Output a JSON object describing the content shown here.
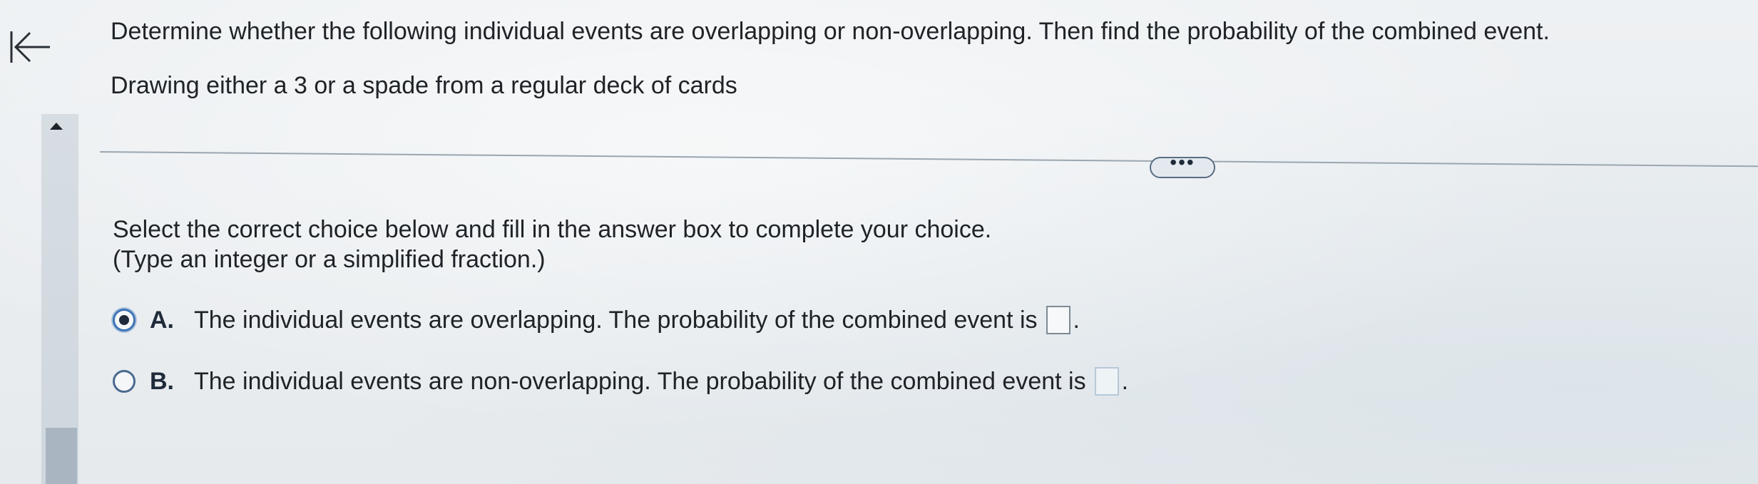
{
  "question": {
    "prompt": "Determine whether the following individual events are overlapping or non-overlapping. Then find the probability of the combined event.",
    "scenario": "Drawing either a 3 or a spade from a regular deck of cards"
  },
  "more_button": {
    "label": "•••"
  },
  "instructions": {
    "line1": "Select the correct choice below and fill in the answer box to complete your choice.",
    "line2": "(Type an integer or a simplified fraction.)"
  },
  "choices": [
    {
      "letter": "A.",
      "text": "The individual events are overlapping. The probability of the combined event is",
      "selected": true,
      "answer_value": ""
    },
    {
      "letter": "B.",
      "text": "The individual events are non-overlapping. The probability of the combined event is",
      "selected": false,
      "answer_value": ""
    }
  ],
  "icons": {
    "back": "back-to-start-icon",
    "scroll_up": "scroll-up-arrow-icon"
  },
  "colors": {
    "accent": "#3d74b5",
    "text": "#1f2226",
    "divider": "#9aa6b0"
  }
}
